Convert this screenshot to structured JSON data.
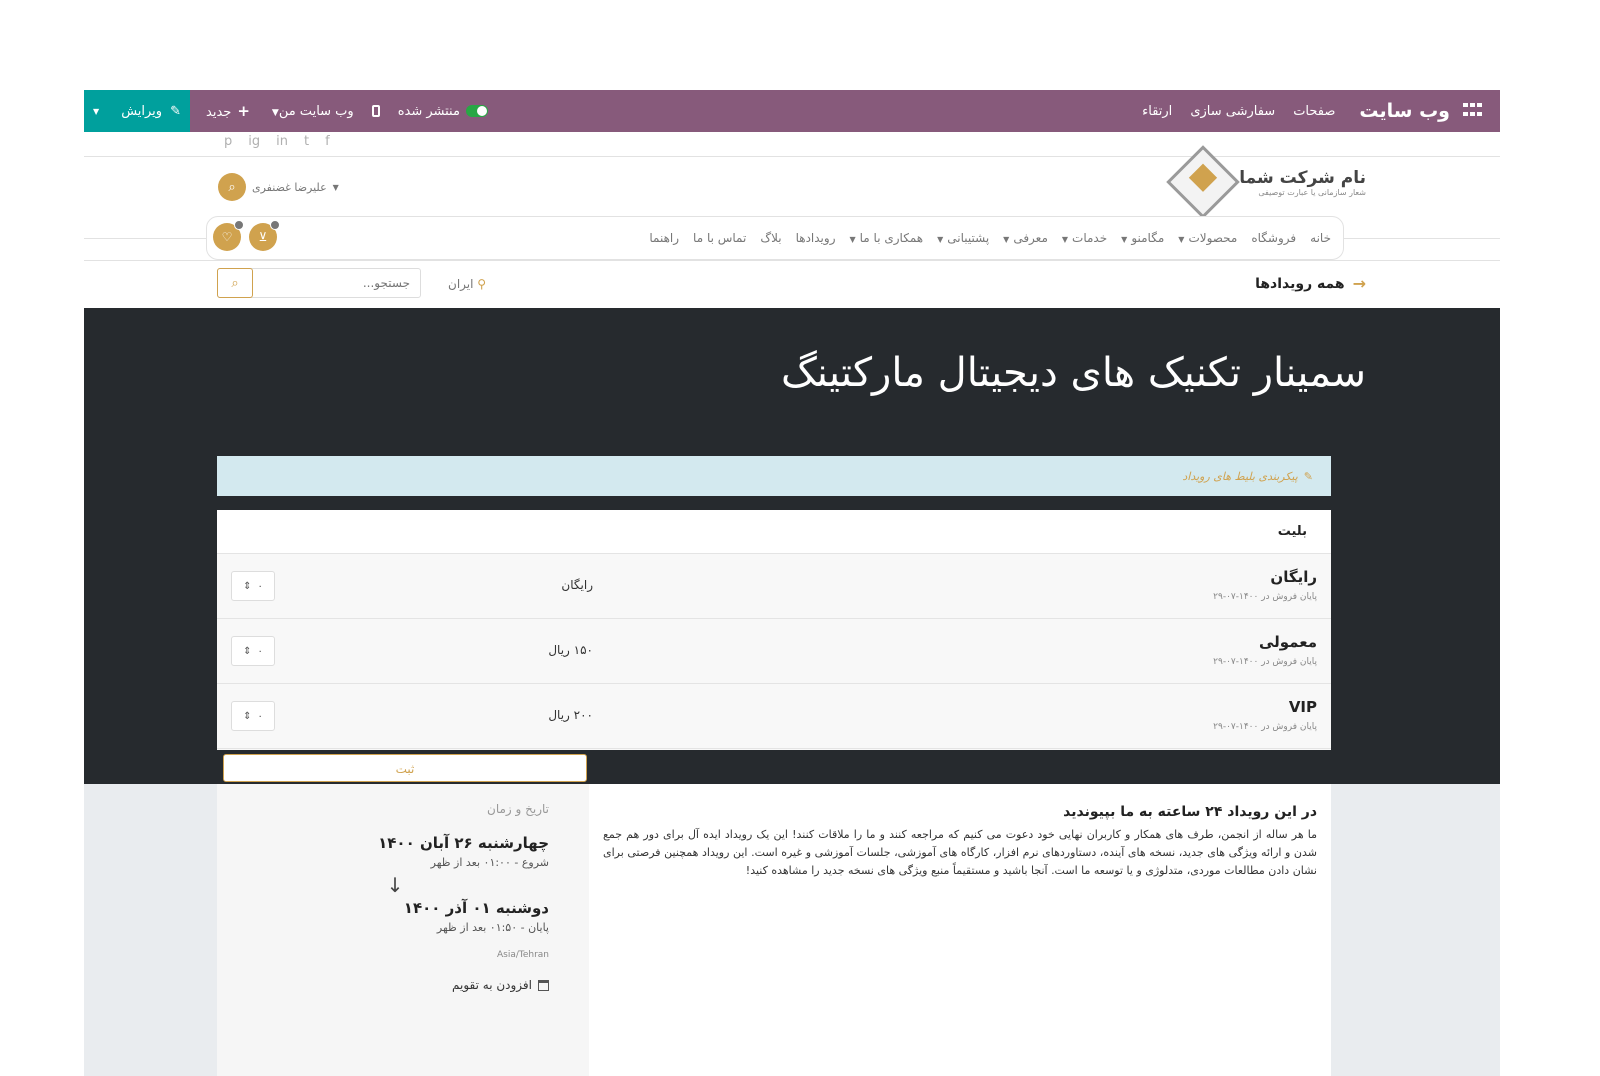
{
  "adminbar": {
    "brand": "وب سایت",
    "menu": [
      "صفحات",
      "سفارشی سازی",
      "ارتقاء"
    ],
    "published": "منتشر شده",
    "my_website": "وب سایت من",
    "new": "جدید",
    "edit": "ویرایش",
    "color": "#875a7b",
    "edit_color": "#00a09d"
  },
  "social": [
    "f",
    "t",
    "in",
    "ig",
    "p"
  ],
  "header": {
    "company_name": "نام شرکت شما",
    "company_tagline": "شعار سازمانی یا عبارت توصیفی",
    "user_name": "علیرضا غضنفری"
  },
  "nav": {
    "items": [
      {
        "label": "خانه",
        "dropdown": false
      },
      {
        "label": "فروشگاه",
        "dropdown": false
      },
      {
        "label": "محصولات",
        "dropdown": true
      },
      {
        "label": "مگامنو",
        "dropdown": true
      },
      {
        "label": "خدمات",
        "dropdown": true
      },
      {
        "label": "معرفی",
        "dropdown": true
      },
      {
        "label": "پشتیبانی",
        "dropdown": true
      },
      {
        "label": "همکاری با ما",
        "dropdown": true
      },
      {
        "label": "رویدادها",
        "dropdown": false
      },
      {
        "label": "بلاگ",
        "dropdown": false
      },
      {
        "label": "تماس با ما",
        "dropdown": false
      },
      {
        "label": "راهنما",
        "dropdown": false
      }
    ]
  },
  "subbar": {
    "all_events": "همه رویدادها",
    "location": "ایران",
    "search_placeholder": "جستجو..."
  },
  "event": {
    "title": "سمینار تکنیک های دیجیتال مارکتینگ"
  },
  "tickets": {
    "configure": "پیکربندی بلیط های رویداد",
    "header": "بلیت",
    "rows": [
      {
        "name": "رایگان",
        "end": "پایان فروش در ۱۴۰۰-۰۷-۲۹",
        "price": "رایگان",
        "qty": "۰"
      },
      {
        "name": "معمولی",
        "end": "پایان فروش در ۱۴۰۰-۰۷-۲۹",
        "price": "۱۵۰ ریال",
        "qty": "۰"
      },
      {
        "name": "VIP",
        "end": "پایان فروش در ۱۴۰۰-۰۷-۲۹",
        "price": "۲۰۰ ریال",
        "qty": "۰"
      }
    ],
    "submit": "ثبت"
  },
  "content": {
    "heading": "در این رویداد ۲۴ ساعته به ما بپیوندید",
    "body": "ما هر ساله از انجمن، طرف های همکار و کاربران نهایی خود دعوت می کنیم که مراجعه کنند و ما را ملاقات کنند! این یک رویداد ایده آل برای دور هم جمع شدن و ارائه ویژگی های جدید، نسخه های آینده، دستاوردهای نرم افزار، کارگاه های آموزشی، جلسات آموزشی و غیره است. این رویداد همچنین فرصتی برای نشان دادن مطالعات موردی، متدلوژی و یا توسعه ما است. آنجا باشید و مستقیماً منبع ویژگی های نسخه جدید را مشاهده کنید!"
  },
  "datetime": {
    "label": "تاریخ و زمان",
    "start_date": "چهارشنبه ۲۶ آبان ۱۴۰۰",
    "start_time": "شروع - ۰۱:۰۰ بعد از ظهر",
    "end_date": "دوشنبه ۰۱ آذر ۱۴۰۰",
    "end_time": "پایان - ۰۱:۵۰ بعد از ظهر",
    "timezone": "Asia/Tehran",
    "add_calendar": "افزودن به تقویم"
  },
  "colors": {
    "accent": "#d0a24e",
    "hero_bg": "#262a2e",
    "alert_bg": "#d3e9ef"
  }
}
